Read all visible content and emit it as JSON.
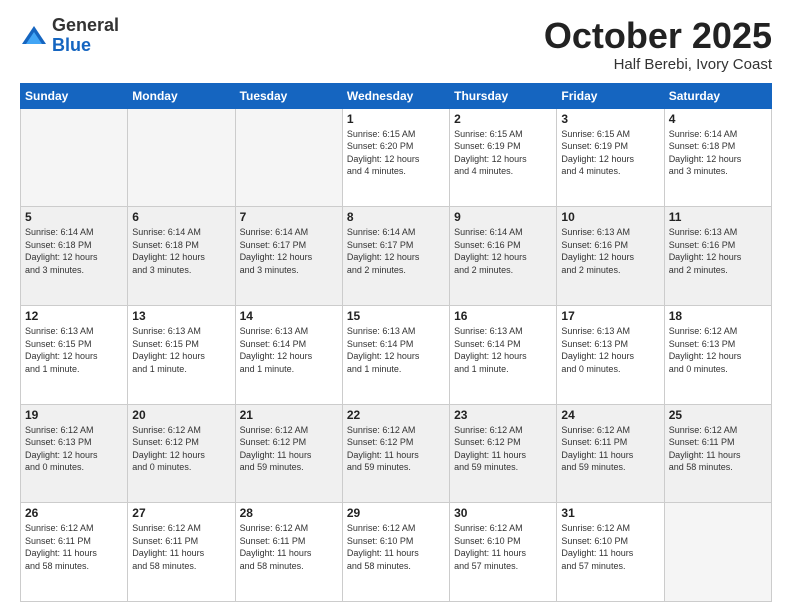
{
  "logo": {
    "general": "General",
    "blue": "Blue"
  },
  "header": {
    "month": "October 2025",
    "location": "Half Berebi, Ivory Coast"
  },
  "weekdays": [
    "Sunday",
    "Monday",
    "Tuesday",
    "Wednesday",
    "Thursday",
    "Friday",
    "Saturday"
  ],
  "weeks": [
    [
      {
        "day": "",
        "info": ""
      },
      {
        "day": "",
        "info": ""
      },
      {
        "day": "",
        "info": ""
      },
      {
        "day": "1",
        "info": "Sunrise: 6:15 AM\nSunset: 6:20 PM\nDaylight: 12 hours\nand 4 minutes."
      },
      {
        "day": "2",
        "info": "Sunrise: 6:15 AM\nSunset: 6:19 PM\nDaylight: 12 hours\nand 4 minutes."
      },
      {
        "day": "3",
        "info": "Sunrise: 6:15 AM\nSunset: 6:19 PM\nDaylight: 12 hours\nand 4 minutes."
      },
      {
        "day": "4",
        "info": "Sunrise: 6:14 AM\nSunset: 6:18 PM\nDaylight: 12 hours\nand 3 minutes."
      }
    ],
    [
      {
        "day": "5",
        "info": "Sunrise: 6:14 AM\nSunset: 6:18 PM\nDaylight: 12 hours\nand 3 minutes."
      },
      {
        "day": "6",
        "info": "Sunrise: 6:14 AM\nSunset: 6:18 PM\nDaylight: 12 hours\nand 3 minutes."
      },
      {
        "day": "7",
        "info": "Sunrise: 6:14 AM\nSunset: 6:17 PM\nDaylight: 12 hours\nand 3 minutes."
      },
      {
        "day": "8",
        "info": "Sunrise: 6:14 AM\nSunset: 6:17 PM\nDaylight: 12 hours\nand 2 minutes."
      },
      {
        "day": "9",
        "info": "Sunrise: 6:14 AM\nSunset: 6:16 PM\nDaylight: 12 hours\nand 2 minutes."
      },
      {
        "day": "10",
        "info": "Sunrise: 6:13 AM\nSunset: 6:16 PM\nDaylight: 12 hours\nand 2 minutes."
      },
      {
        "day": "11",
        "info": "Sunrise: 6:13 AM\nSunset: 6:16 PM\nDaylight: 12 hours\nand 2 minutes."
      }
    ],
    [
      {
        "day": "12",
        "info": "Sunrise: 6:13 AM\nSunset: 6:15 PM\nDaylight: 12 hours\nand 1 minute."
      },
      {
        "day": "13",
        "info": "Sunrise: 6:13 AM\nSunset: 6:15 PM\nDaylight: 12 hours\nand 1 minute."
      },
      {
        "day": "14",
        "info": "Sunrise: 6:13 AM\nSunset: 6:14 PM\nDaylight: 12 hours\nand 1 minute."
      },
      {
        "day": "15",
        "info": "Sunrise: 6:13 AM\nSunset: 6:14 PM\nDaylight: 12 hours\nand 1 minute."
      },
      {
        "day": "16",
        "info": "Sunrise: 6:13 AM\nSunset: 6:14 PM\nDaylight: 12 hours\nand 1 minute."
      },
      {
        "day": "17",
        "info": "Sunrise: 6:13 AM\nSunset: 6:13 PM\nDaylight: 12 hours\nand 0 minutes."
      },
      {
        "day": "18",
        "info": "Sunrise: 6:12 AM\nSunset: 6:13 PM\nDaylight: 12 hours\nand 0 minutes."
      }
    ],
    [
      {
        "day": "19",
        "info": "Sunrise: 6:12 AM\nSunset: 6:13 PM\nDaylight: 12 hours\nand 0 minutes."
      },
      {
        "day": "20",
        "info": "Sunrise: 6:12 AM\nSunset: 6:12 PM\nDaylight: 12 hours\nand 0 minutes."
      },
      {
        "day": "21",
        "info": "Sunrise: 6:12 AM\nSunset: 6:12 PM\nDaylight: 11 hours\nand 59 minutes."
      },
      {
        "day": "22",
        "info": "Sunrise: 6:12 AM\nSunset: 6:12 PM\nDaylight: 11 hours\nand 59 minutes."
      },
      {
        "day": "23",
        "info": "Sunrise: 6:12 AM\nSunset: 6:12 PM\nDaylight: 11 hours\nand 59 minutes."
      },
      {
        "day": "24",
        "info": "Sunrise: 6:12 AM\nSunset: 6:11 PM\nDaylight: 11 hours\nand 59 minutes."
      },
      {
        "day": "25",
        "info": "Sunrise: 6:12 AM\nSunset: 6:11 PM\nDaylight: 11 hours\nand 58 minutes."
      }
    ],
    [
      {
        "day": "26",
        "info": "Sunrise: 6:12 AM\nSunset: 6:11 PM\nDaylight: 11 hours\nand 58 minutes."
      },
      {
        "day": "27",
        "info": "Sunrise: 6:12 AM\nSunset: 6:11 PM\nDaylight: 11 hours\nand 58 minutes."
      },
      {
        "day": "28",
        "info": "Sunrise: 6:12 AM\nSunset: 6:11 PM\nDaylight: 11 hours\nand 58 minutes."
      },
      {
        "day": "29",
        "info": "Sunrise: 6:12 AM\nSunset: 6:10 PM\nDaylight: 11 hours\nand 58 minutes."
      },
      {
        "day": "30",
        "info": "Sunrise: 6:12 AM\nSunset: 6:10 PM\nDaylight: 11 hours\nand 57 minutes."
      },
      {
        "day": "31",
        "info": "Sunrise: 6:12 AM\nSunset: 6:10 PM\nDaylight: 11 hours\nand 57 minutes."
      },
      {
        "day": "",
        "info": ""
      }
    ]
  ],
  "shaded_rows": [
    1,
    3
  ]
}
